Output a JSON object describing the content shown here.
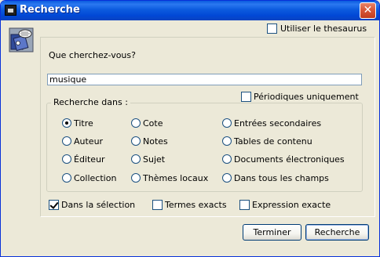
{
  "window": {
    "title": "Recherche"
  },
  "options": {
    "thesaurus_label": "Utiliser le thesaurus",
    "thesaurus_checked": false
  },
  "query": {
    "label": "Que cherchez-vous?",
    "value": "musique"
  },
  "periodiques": {
    "label": "Périodiques uniquement",
    "checked": false
  },
  "search_in": {
    "legend": "Recherche dans :",
    "fields": [
      {
        "label": "Titre",
        "selected": true
      },
      {
        "label": "Auteur",
        "selected": false
      },
      {
        "label": "Éditeur",
        "selected": false
      },
      {
        "label": "Collection",
        "selected": false
      },
      {
        "label": "Cote",
        "selected": false
      },
      {
        "label": "Notes",
        "selected": false
      },
      {
        "label": "Sujet",
        "selected": false
      },
      {
        "label": "Thèmes locaux",
        "selected": false
      },
      {
        "label": "Entrées secondaires",
        "selected": false
      },
      {
        "label": "Tables de contenu",
        "selected": false
      },
      {
        "label": "Documents électroniques",
        "selected": false
      },
      {
        "label": "Dans tous les champs",
        "selected": false
      }
    ]
  },
  "filters": [
    {
      "label": "Dans la sélection",
      "checked": true
    },
    {
      "label": "Termes exacts",
      "checked": false
    },
    {
      "label": "Expression exacte",
      "checked": false
    }
  ],
  "buttons": {
    "terminer": "Terminer",
    "recherche": "Recherche"
  },
  "icons": {
    "app": "application-icon",
    "close": "close-icon",
    "mascot": "dictionary-mascot-icon"
  },
  "colors": {
    "titlebar": "#0148d6",
    "face": "#ece9d8",
    "close": "#d9583a"
  }
}
